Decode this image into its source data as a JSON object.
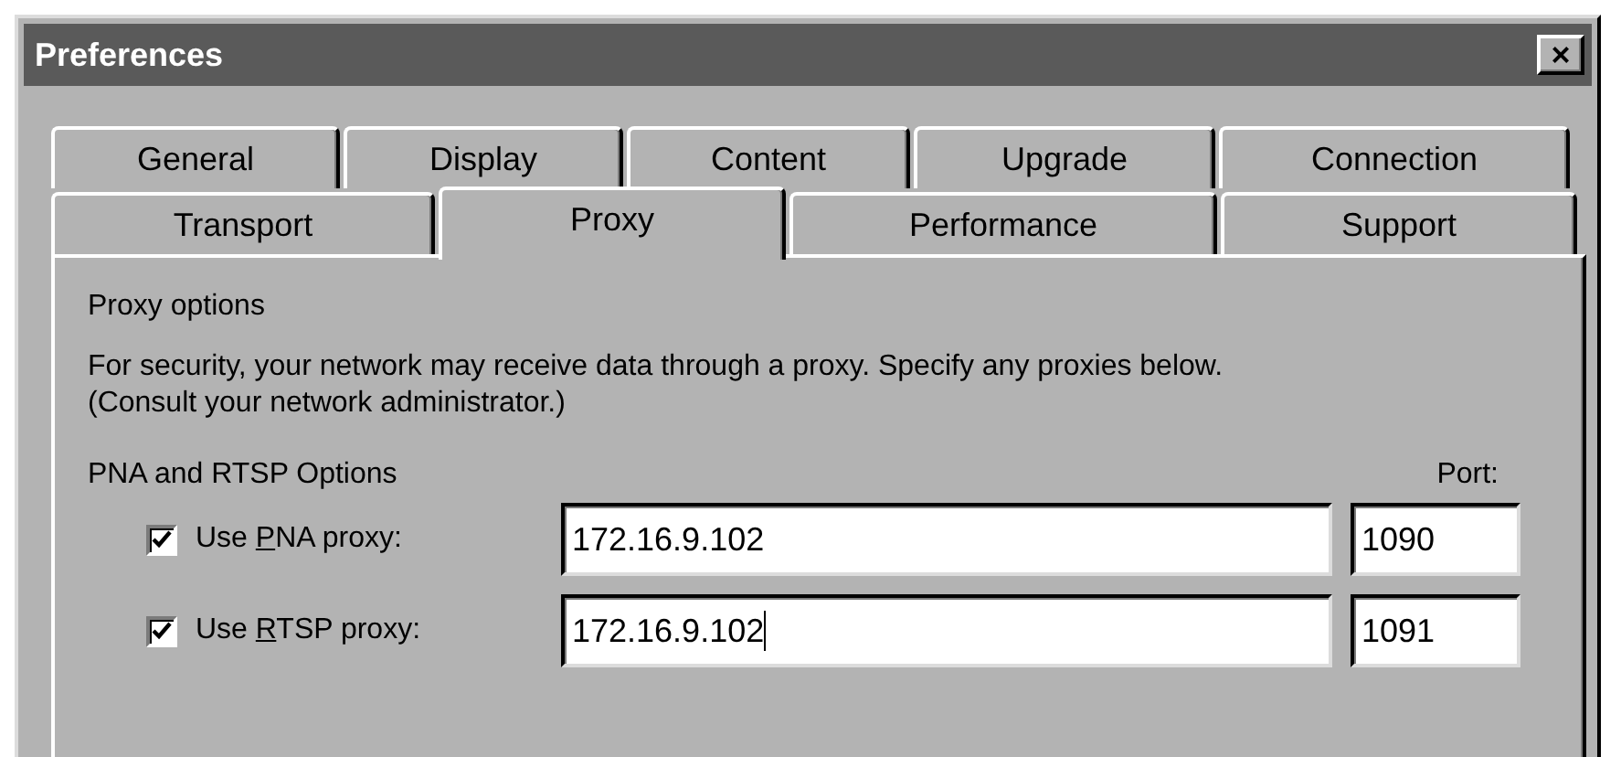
{
  "window": {
    "title": "Preferences",
    "close_button": "×"
  },
  "tab_rows": [
    {
      "tabs": [
        {
          "label": "General",
          "selected": false
        },
        {
          "label": "Display",
          "selected": false
        },
        {
          "label": "Content",
          "selected": false
        },
        {
          "label": "Upgrade",
          "selected": false
        },
        {
          "label": "Connection",
          "selected": false
        }
      ]
    },
    {
      "tabs": [
        {
          "label": "Transport",
          "selected": false
        },
        {
          "label": "Proxy",
          "selected": true
        },
        {
          "label": "Performance",
          "selected": false
        },
        {
          "label": "Support",
          "selected": false
        }
      ]
    }
  ],
  "panel": {
    "heading": "Proxy options",
    "description": "For security, your network may receive data through a proxy. Specify any proxies below. (Consult your network administrator.)",
    "group_label": "PNA and RTSP Options",
    "port_label": "Port:",
    "proxies": [
      {
        "label_before": "Use ",
        "mnemonic": "P",
        "label_after": "NA proxy:",
        "checked": true,
        "host": "172.16.9.102",
        "port": "1090",
        "focused": false
      },
      {
        "label_before": "Use ",
        "mnemonic": "R",
        "label_after": "TSP proxy:",
        "checked": true,
        "host": "172.16.9.102",
        "port": "1091",
        "focused": true
      }
    ]
  }
}
